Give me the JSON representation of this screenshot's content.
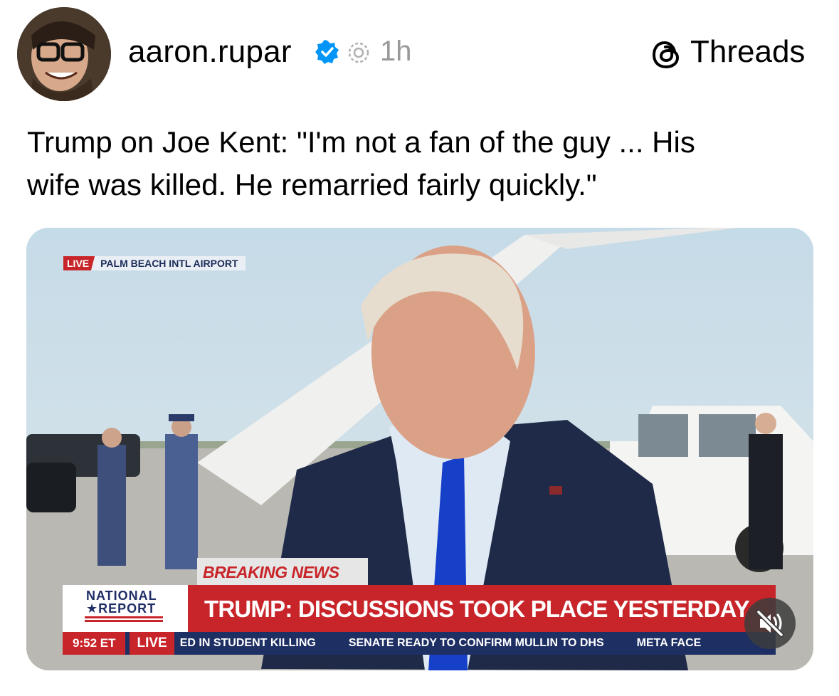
{
  "post": {
    "username": "aaron.rupar",
    "time": "1h",
    "source": "Threads",
    "text_line1": "Trump on Joe Kent: \"I'm not a fan of the guy ... His",
    "text_line2": "wife was killed. He remarried fairly quickly.\""
  },
  "video": {
    "live_label": "LIVE",
    "location": "PALM BEACH INTL AIRPORT",
    "breaking": "BREAKING NEWS",
    "network_line1": "NATIONAL",
    "network_line2": "★REPORT",
    "headline": "TRUMP: DISCUSSIONS TOOK PLACE YESTERDAY",
    "clock": "9:52 ET",
    "ticker_live": "LIVE",
    "ticker_items": [
      "ED IN STUDENT KILLING",
      "SENATE READY TO CONFIRM MULLIN TO DHS",
      "META FACE"
    ]
  },
  "colors": {
    "accent_red": "#c8252a",
    "navy": "#1e2f64",
    "verified_blue": "#0095f6",
    "muted_gray": "#999999"
  },
  "icons": [
    "verified-badge-icon",
    "threads-logo-icon",
    "edited-time-icon",
    "mute-icon"
  ]
}
